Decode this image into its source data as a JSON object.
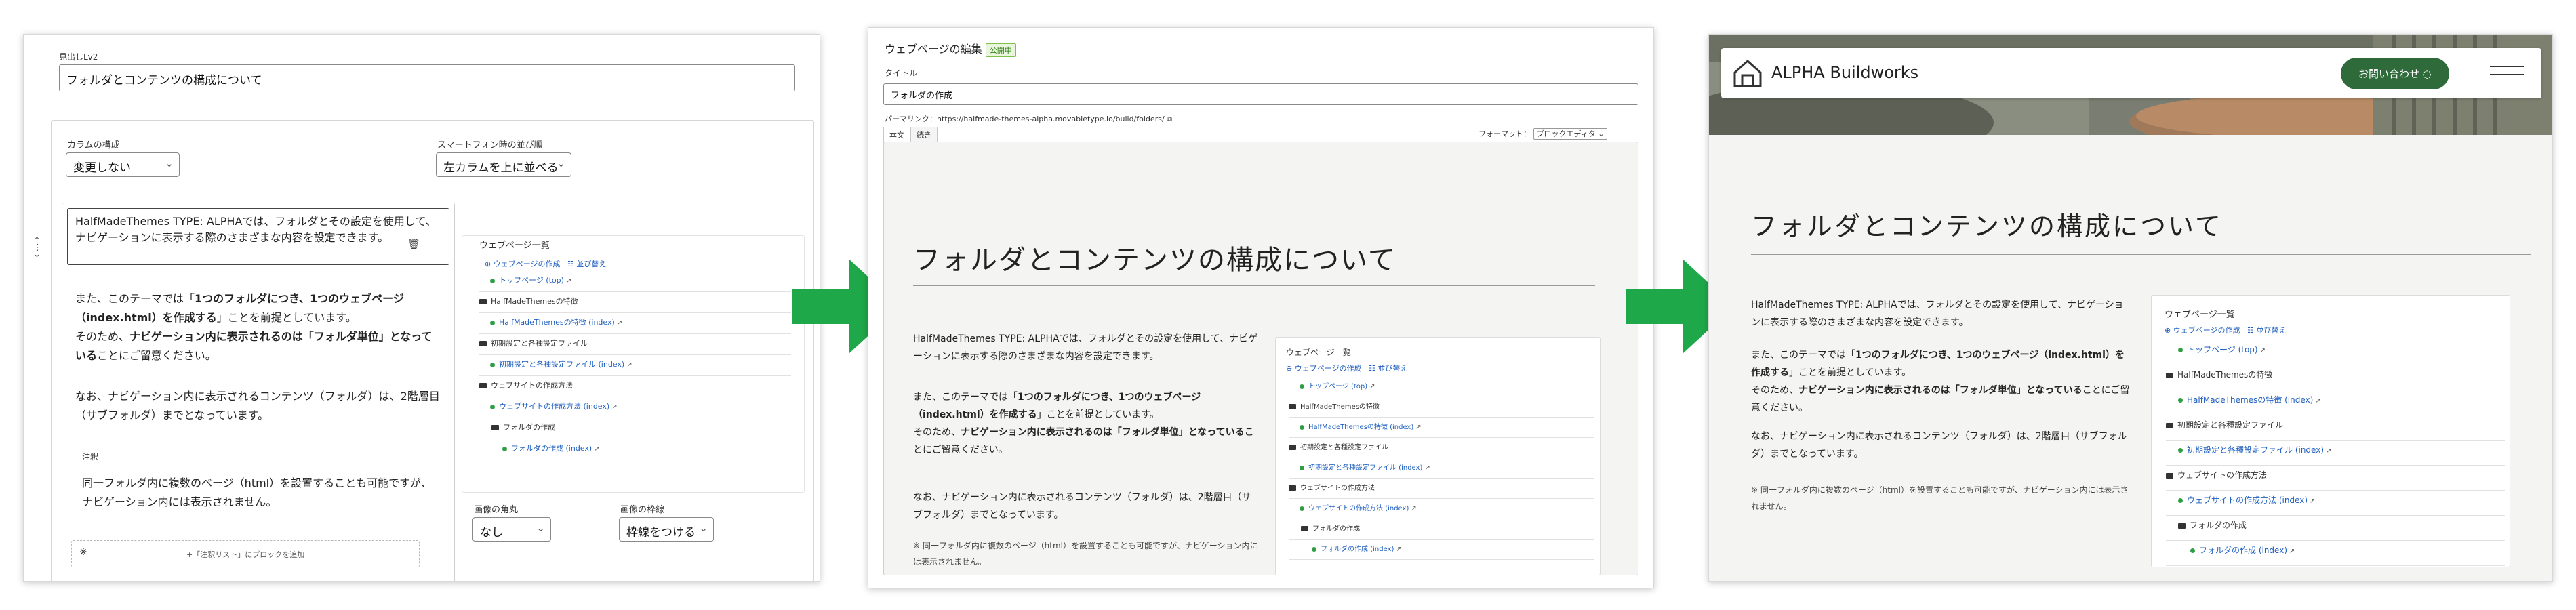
{
  "editor": {
    "heading_label": "見出しLv2",
    "heading_value": "フォルダとコンテンツの構成について",
    "column_label": "カラムの構成",
    "column_value": "変更しない",
    "sp_label": "スマートフォン時の並び順",
    "sp_value": "左カラムを上に並べる",
    "para1": "HalfMadeThemes TYPE: ALPHAでは、フォルダとその設定を使用して、ナビゲーションに表示する際のさまざまな内容を設定できます。",
    "para2_a": "また、このテーマでは「",
    "para2_b": "1つのフォルダにつき、1つのウェブページ（index.html）を作成する",
    "para2_c": "」ことを前提としています。",
    "para2_d": "そのため、",
    "para2_e": "ナビゲーション内に表示されるのは「フォルダ単位」となっている",
    "para2_f": "ことにご留意ください。",
    "para3": "なお、ナビゲーション内に表示されるコンテンツ（フォルダ）は、2階層目（サブフォルダ）までとなっています。",
    "note_label": "注釈",
    "note_text": "同一フォルダ内に複数のページ（html）を設置することも可能ですが、ナビゲーション内には表示されません。",
    "note_mark": "※",
    "add_block": "+「注釈リスト」にブロックを追加",
    "image_corner_label": "画像の角丸",
    "image_corner_value": "なし",
    "image_border_label": "画像の枠線",
    "image_border_value": "枠線をつける",
    "trash": "🗑"
  },
  "nav_list": {
    "title": "ウェブページ一覧",
    "controls_a": "ウェブページの作成",
    "controls_b": "並び替え",
    "items": [
      {
        "label": "トップページ (top)",
        "kind": "page"
      },
      {
        "label": "HalfMadeThemesの特徴",
        "kind": "folder"
      },
      {
        "label": "HalfMadeThemesの特徴 (index)",
        "kind": "page"
      },
      {
        "label": "初期設定と各種設定ファイル",
        "kind": "folder"
      },
      {
        "label": "初期設定と各種設定ファイル (index)",
        "kind": "page"
      },
      {
        "label": "ウェブサイトの作成方法",
        "kind": "folder"
      },
      {
        "label": "ウェブサイトの作成方法 (index)",
        "kind": "page"
      },
      {
        "label": "フォルダの作成",
        "kind": "folder"
      },
      {
        "label": "フォルダの作成 (index)",
        "kind": "page"
      }
    ]
  },
  "webpage_edit": {
    "title": "ウェブページの編集",
    "status_badge": "公開中",
    "title_label": "タイトル",
    "title_value": "フォルダの作成",
    "permalink_label": "パーマリンク：",
    "permalink_value": "https://halfmade-themes-alpha.movabletype.io/build/folders/",
    "tab_body": "本文",
    "tab_more": "続き",
    "format_label": "フォーマット：",
    "format_value": "ブロックエディタ",
    "heading": "フォルダとコンテンツの構成について",
    "p1": "HalfMadeThemes TYPE: ALPHAでは、フォルダとその設定を使用して、ナビゲーションに表示する際のさまざまな内容を設定できます。",
    "p2_a": "また、このテーマでは「",
    "p2_b": "1つのフォルダにつき、1つのウェブページ（index.html）を作成する",
    "p2_c": "」ことを前提としています。",
    "p2_d": "そのため、",
    "p2_e": "ナビゲーション内に表示されるのは「フォルダ単位」となっている",
    "p2_f": "ことにご留意ください。",
    "p3": "なお、ナビゲーション内に表示されるコンテンツ（フォルダ）は、2階層目（サブフォルダ）までとなっています。",
    "note": "※ 同一フォルダ内に複数のページ（html）を設置することも可能ですが、ナビゲーション内には表示されません。"
  },
  "site": {
    "brand": "ALPHA Buildworks",
    "contact": "お問い合わせ",
    "heading": "フォルダとコンテンツの構成について",
    "p1": "HalfMadeThemes TYPE: ALPHAでは、フォルダとその設定を使用して、ナビゲーションに表示する際のさまざまな内容を設定できます。",
    "p2_a": "また、このテーマでは「",
    "p2_b": "1つのフォルダにつき、1つのウェブページ（index.html）を作成する",
    "p2_c": "」ことを前提としています。",
    "p2_d": "そのため、",
    "p2_e": "ナビゲーション内に表示されるのは「フォルダ単位」となっている",
    "p2_f": "ことにご留意ください。",
    "p3": "なお、ナビゲーション内に表示されるコンテンツ（フォルダ）は、2階層目（サブフォルダ）までとなっています。",
    "note": "※ 同一フォルダ内に複数のページ（html）を設置することも可能ですが、ナビゲーション内には表示されません。"
  },
  "colors": {
    "arrow": "#1fa84a",
    "accent_green": "#2f6b3a",
    "link": "#1f5fbf"
  }
}
